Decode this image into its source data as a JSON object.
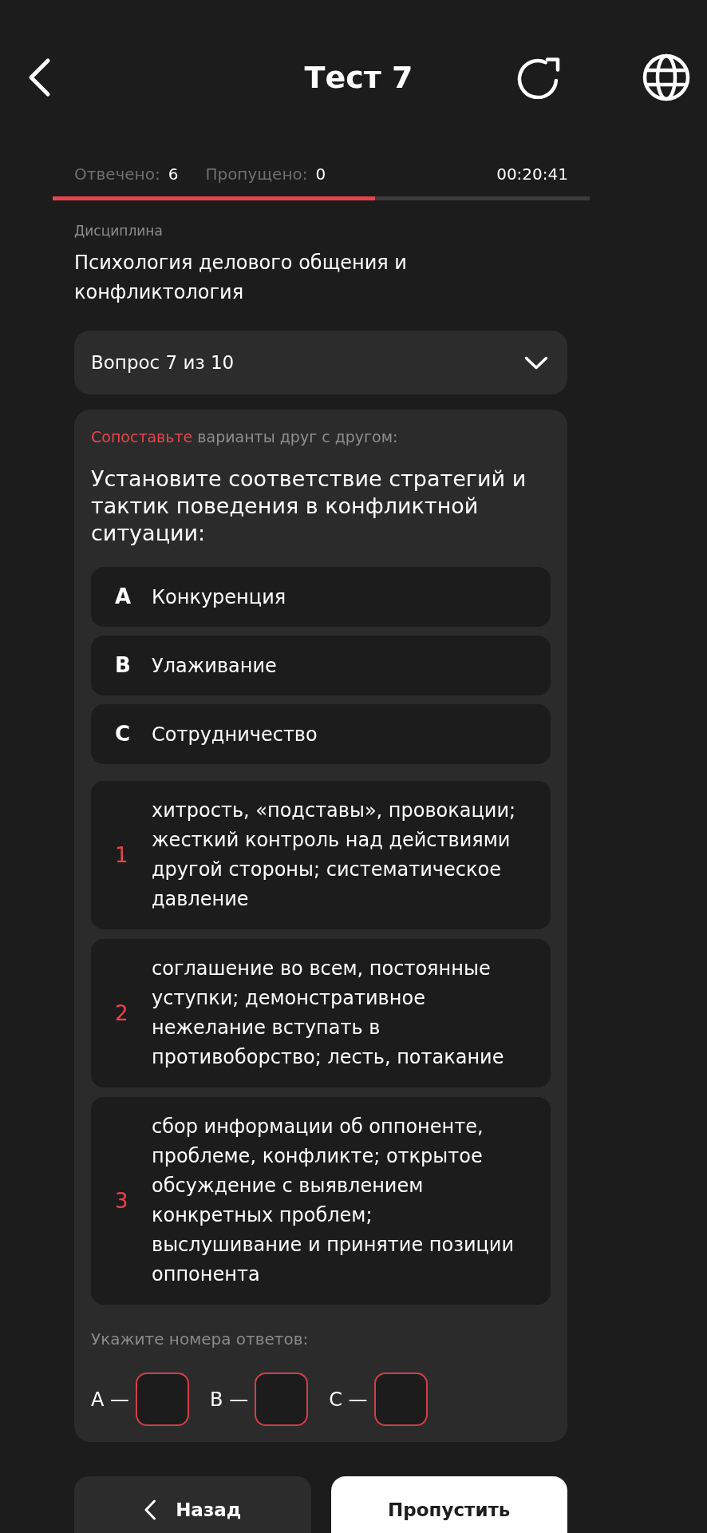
{
  "header": {
    "title": "Тест 7"
  },
  "progress": {
    "answered_label": "Отвечено:",
    "answered": "6",
    "skipped_label": "Пропущено:",
    "skipped": "0",
    "timer": "00:20:41",
    "level": 0.6
  },
  "discipline": {
    "label": "Дисциплина",
    "name": "Психология делового общения и конфликтология"
  },
  "question_selector": {
    "label": "Вопрос 7 из 10",
    "expanded": false
  },
  "question": {
    "instruction": {
      "highlight": "Сопоставьте",
      "rest": "варианты друг с другом:"
    },
    "text": "Установите соответствие стратегий и тактик поведения в конфликтной ситуации:",
    "options": [
      {
        "letter": "A",
        "text": "Конкуренция"
      },
      {
        "letter": "B",
        "text": "Улаживание"
      },
      {
        "letter": "C",
        "text": "Сотрудничество"
      }
    ],
    "matches": [
      {
        "number": "1",
        "text": "хитрость, «подставы», провокации; жесткий контроль над действиями другой стороны; систематическое давление"
      },
      {
        "number": "2",
        "text": "соглашение во всем, постоянные уступки; демонстративное нежелание вступать в противоборство; лесть, потакание"
      },
      {
        "number": "3",
        "text": "сбор информации об оппоненте, проблеме, конфликте; открытое обсуждение с выявлением конкретных проблем; выслушивание и принятие позиции оппонента"
      }
    ],
    "answer_prompt": "Укажите номера ответов:",
    "answers": [
      {
        "label": "A —"
      },
      {
        "label": "B —"
      },
      {
        "label": "C —"
      }
    ]
  },
  "buttons": [
    {
      "kind": "back",
      "label": "Назад"
    },
    {
      "kind": "skip",
      "label": "Пропустить"
    }
  ]
}
